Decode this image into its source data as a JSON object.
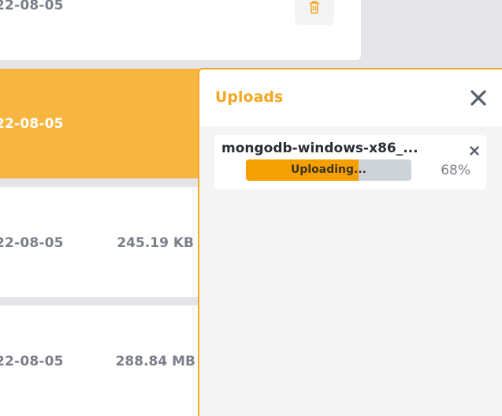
{
  "files": [
    {
      "date": "22-08-05",
      "size": ""
    },
    {
      "date": "22-08-05",
      "size": ""
    },
    {
      "date": "22-08-05",
      "size": "245.19 KB"
    },
    {
      "date": "22-08-05",
      "size": "288.84 MB"
    }
  ],
  "uploads_panel": {
    "title": "Uploads",
    "items": [
      {
        "filename": "mongodb-windows-x86_...",
        "status": "Uploading...",
        "progress_percent": 68,
        "progress_text": "68%"
      }
    ]
  },
  "icons": {
    "delete": "trash-icon",
    "close_panel": "close-icon",
    "remove_item": "close-icon"
  },
  "colors": {
    "accent": "#f5a623",
    "selected_row": "#f7b63f",
    "progress_fill": "#f5a000",
    "progress_track": "#cdd3db",
    "text_muted": "#7b7f8a"
  }
}
